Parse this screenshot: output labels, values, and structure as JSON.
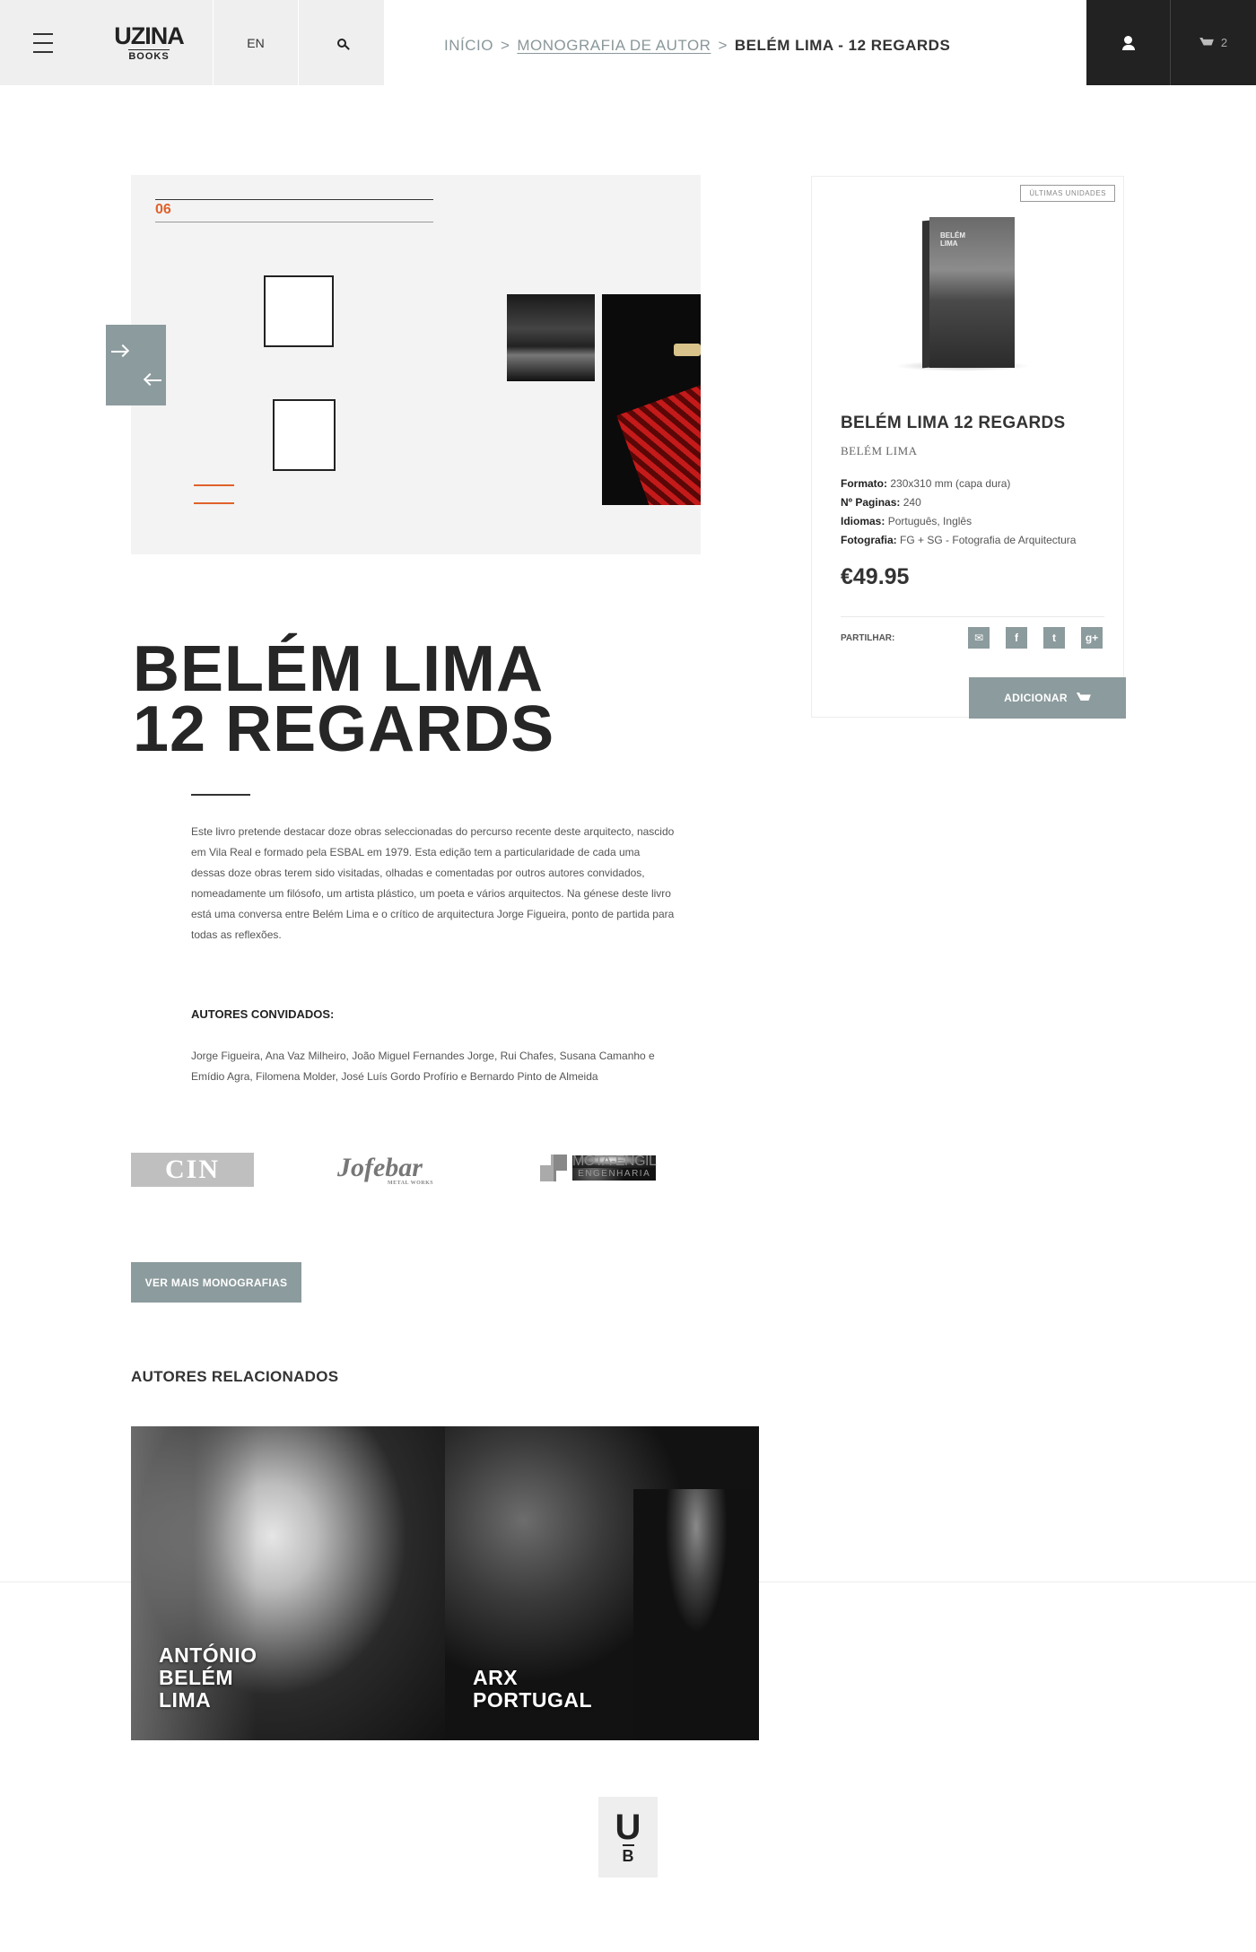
{
  "header": {
    "logo_main": "UZINA",
    "logo_sub": "BOOKS",
    "lang": "EN",
    "cart_count": "2",
    "icons": [
      "menu-icon",
      "search-icon",
      "user-icon",
      "cart-icon"
    ]
  },
  "breadcrumb": {
    "home": "INÍCIO",
    "sep": ">",
    "category": "MONOGRAFIA DE AUTOR",
    "current": "BELÉM LIMA - 12 REGARDS"
  },
  "gallery": {
    "page_number": "06"
  },
  "product": {
    "badge": "ÚLTIMAS UNIDADES",
    "cover_text_1": "BELÉM",
    "cover_text_2": "LIMA",
    "title": "BELÉM LIMA 12 REGARDS",
    "author": "BELÉM LIMA",
    "specs": [
      {
        "label": "Formato:",
        "value": "230x310 mm (capa dura)"
      },
      {
        "label": "Nº Paginas:",
        "value": "240"
      },
      {
        "label": "Idiomas:",
        "value": "Português, Inglês"
      },
      {
        "label": "Fotografia:",
        "value": "FG + SG - Fotografia de Arquitectura"
      }
    ],
    "price": "€49.95",
    "share_label": "PARTILHAR:",
    "share_icons": [
      "mail-icon",
      "facebook-icon",
      "twitter-icon",
      "googleplus-icon"
    ],
    "add_label": "ADICIONAR"
  },
  "main": {
    "title_line1": "BELÉM LIMA",
    "title_line2": "12 REGARDS",
    "description": "Este livro pretende destacar doze obras seleccionadas do percurso recente deste arquitecto, nascido em Vila Real e formado pela ESBAL em 1979. Esta edição tem a particularidade de cada uma dessas doze obras terem sido visitadas, olhadas e comentadas por outros autores convidados, nomeadamente um filósofo, um artista plástico, um poeta e vários arquitectos. Na génese deste livro está uma conversa entre Belém Lima e o crítico de arquitectura Jorge Figueira, ponto de partida para todas as reflexões.",
    "authors_heading": "AUTORES CONVIDADOS:",
    "authors_text": "Jorge Figueira, Ana Vaz Milheiro, João Miguel Fernandes Jorge, Rui Chafes, Susana Camanho e Emídio Agra, Filomena Molder, José Luís Gordo Profírio e Bernardo Pinto de Almeida"
  },
  "sponsors": {
    "cin": "CIN",
    "jofebar": "Jofebar",
    "jofebar_sub": "METAL WORKS",
    "mota": "MOTA-ENGIL",
    "mota_sub": "ENGENHARIA"
  },
  "more_button": "VER MAIS MONOGRAFIAS",
  "related": {
    "heading": "AUTORES RELACIONADOS",
    "items": [
      {
        "lines": [
          "ANTÓNIO",
          "BELÉM",
          "LIMA"
        ]
      },
      {
        "lines": [
          "ARX",
          "PORTUGAL"
        ]
      }
    ]
  },
  "footer": {
    "logo_u": "U",
    "logo_b": "B"
  },
  "colors": {
    "accent": "#8c9b9d",
    "dark": "#222222",
    "highlight": "#e0612a"
  }
}
